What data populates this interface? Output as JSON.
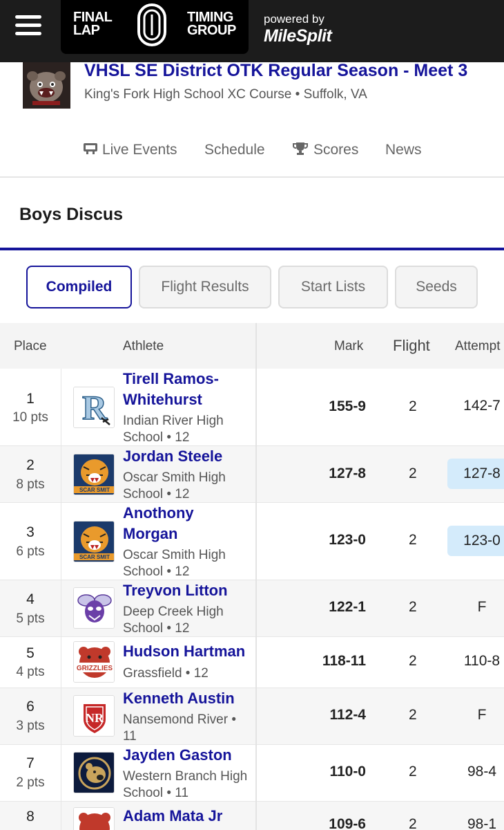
{
  "header": {
    "brand_left": [
      "FINAL",
      "LAP"
    ],
    "brand_right": [
      "TIMING",
      "GROUP"
    ],
    "powered_by": "powered by",
    "powered_brand": "MileSplit"
  },
  "meet": {
    "title": "VHSL SE District OTK Regular Season - Meet 3",
    "location": "King's Fork High School XC Course • Suffolk, VA"
  },
  "nav": {
    "items": [
      "Live Events",
      "Schedule",
      "Scores",
      "News"
    ]
  },
  "event": {
    "title": "Boys Discus"
  },
  "tabs": [
    "Compiled",
    "Flight Results",
    "Start Lists",
    "Seeds"
  ],
  "table": {
    "headers": [
      "Place",
      "Athlete",
      "Mark",
      "Flight",
      "Attempt"
    ],
    "rows": [
      {
        "place": "1",
        "pts": "10 pts",
        "name": "Tirell Ramos-Whitehurst",
        "school": "Indian River High School • 12",
        "mark": "155-9",
        "flight": "2",
        "attempt": "142-7"
      },
      {
        "place": "2",
        "pts": "8 pts",
        "name": "Jordan Steele",
        "school": "Oscar Smith High School • 12",
        "mark": "127-8",
        "flight": "2",
        "attempt": "127-8"
      },
      {
        "place": "3",
        "pts": "6 pts",
        "name": "Anothony Morgan",
        "school": "Oscar Smith High School • 12",
        "mark": "123-0",
        "flight": "2",
        "attempt": "123-0"
      },
      {
        "place": "4",
        "pts": "5 pts",
        "name": "Treyvon Litton",
        "school": "Deep Creek High School • 12",
        "mark": "122-1",
        "flight": "2",
        "attempt": "F"
      },
      {
        "place": "5",
        "pts": "4 pts",
        "name": "Hudson Hartman",
        "school": "Grassfield • 12",
        "mark": "118-11",
        "flight": "2",
        "attempt": "110-8"
      },
      {
        "place": "6",
        "pts": "3 pts",
        "name": "Kenneth Austin",
        "school": "Nansemond River • 11",
        "mark": "112-4",
        "flight": "2",
        "attempt": "F"
      },
      {
        "place": "7",
        "pts": "2 pts",
        "name": "Jayden Gaston",
        "school": "Western Branch High School • 11",
        "mark": "110-0",
        "flight": "2",
        "attempt": "98-4"
      },
      {
        "place": "8",
        "pts": "",
        "name": "Adam Mata Jr",
        "school": "",
        "mark": "109-6",
        "flight": "2",
        "attempt": "98-1"
      }
    ]
  },
  "colors": {
    "accent": "#15149a",
    "highlight": "#d4ebfb",
    "annotation_line": "#c0392b"
  }
}
